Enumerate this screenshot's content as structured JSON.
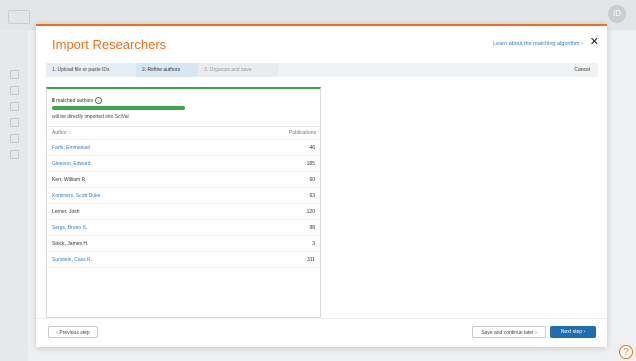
{
  "background": {
    "avatar_initial": "ID"
  },
  "modal": {
    "title": "Import Researchers",
    "learn_link": "Learn about the matching algorithm ›",
    "close_glyph": "✕"
  },
  "stepper": {
    "steps": [
      {
        "label": "1. Upload file or paste IDs",
        "state": "done"
      },
      {
        "label": "2. Refine authors",
        "state": "active"
      },
      {
        "label": "3. Organize and save",
        "state": "upcoming"
      }
    ],
    "cancel_label": "Cancel"
  },
  "panel": {
    "match_count": "8",
    "match_text": " matched authors",
    "info_glyph": "i",
    "match_fraction": 1.0,
    "import_note": "will be directly imported into SciVal",
    "columns": {
      "author": "Author",
      "sort_glyph": "↑",
      "publications": "Publications"
    },
    "rows": [
      {
        "name": "Farhi, Emmanuel",
        "count": "46",
        "link": true
      },
      {
        "name": "Gleeson, Edward",
        "count": "185",
        "link": true
      },
      {
        "name": "Kerr, William R.",
        "count": "60",
        "link": false
      },
      {
        "name": "Kominers, Scott Duke",
        "count": "63",
        "link": true
      },
      {
        "name": "Lerner, Josh",
        "count": "120",
        "link": false
      },
      {
        "name": "Sergs, Bruno S.",
        "count": "98",
        "link": true
      },
      {
        "name": "Stock, James H.",
        "count": "3",
        "link": false
      },
      {
        "name": "Sunstein, Cass R.",
        "count": "311",
        "link": true
      }
    ]
  },
  "footer": {
    "prev_label": "‹ Previous step",
    "save_label": "Save and continue later ›",
    "next_label": "Next step ›"
  },
  "help_glyph": "?",
  "colors": {
    "accent_orange": "#e9711c",
    "link_blue": "#2f7dc7",
    "success_green": "#3fa64a",
    "primary_button": "#1f6fae"
  }
}
